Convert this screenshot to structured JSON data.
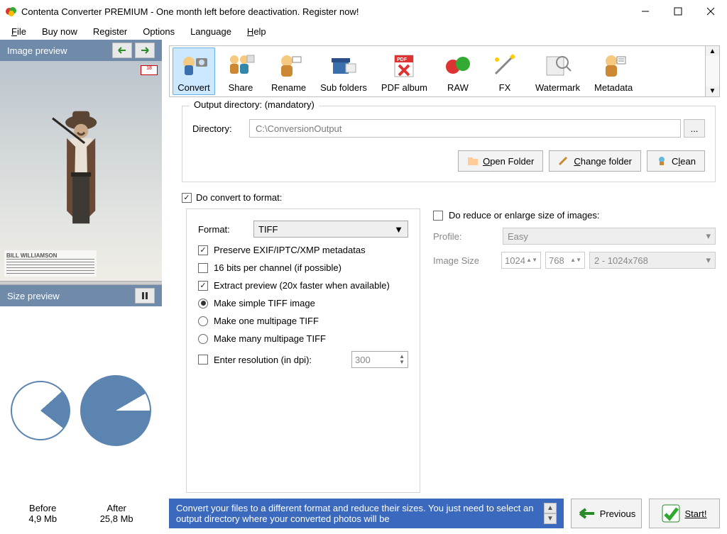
{
  "titlebar": {
    "text": "Contenta Converter PREMIUM  - One month left before deactivation. Register now!"
  },
  "menubar": {
    "file": "File",
    "file_u": "F",
    "buynow": "Buy now",
    "register": "Register",
    "options": "Options",
    "language": "Language",
    "help": "Help",
    "help_u": "H"
  },
  "sidebar": {
    "image_preview": "Image preview",
    "size_preview": "Size preview",
    "before_label": "Before",
    "before_value": "4,9 Mb",
    "after_label": "After",
    "after_value": "25,8 Mb",
    "caption_text": "BILL WILLIAMSON"
  },
  "toolbar": {
    "convert": "Convert",
    "share": "Share",
    "rename": "Rename",
    "subfolders": "Sub folders",
    "pdf": "PDF album",
    "raw": "RAW",
    "fx": "FX",
    "watermark": "Watermark",
    "metadata": "Metadata"
  },
  "output": {
    "group_title": "Output directory: (mandatory)",
    "dir_label": "Directory:",
    "dir_value": "C:\\ConversionOutput",
    "browse": "...",
    "open_folder": "Open Folder",
    "change_folder": "Change folder",
    "clean": "Clean"
  },
  "convert": {
    "do_convert": "Do convert to format:",
    "format_label": "Format:",
    "format_value": "TIFF",
    "preserve": "Preserve EXIF/IPTC/XMP metadatas",
    "bits16": "16 bits per channel (if possible)",
    "extract": "Extract preview (20x faster when available)",
    "radio_simple": "Make simple TIFF image",
    "radio_one": "Make one multipage TIFF",
    "radio_many": "Make many multipage TIFF",
    "enter_res": "Enter resolution (in dpi):",
    "res_value": "300"
  },
  "resize": {
    "do_reduce": "Do reduce or enlarge size of images:",
    "profile_label": "Profile:",
    "profile_value": "Easy",
    "imgsize_label": "Image Size",
    "width": "1024",
    "height": "768",
    "preset": "2 - 1024x768"
  },
  "footer": {
    "info": "Convert your files to a different format and reduce their sizes. You just need to select an output directory where your converted photos will be",
    "previous": "Previous",
    "start": "Start!"
  },
  "chart_data": {
    "type": "pie",
    "series": [
      {
        "name": "Before",
        "total_mb": 4.9,
        "slices": [
          {
            "label": "filled",
            "value": 22
          },
          {
            "label": "empty",
            "value": 78
          }
        ]
      },
      {
        "name": "After",
        "total_mb": 25.8,
        "slices": [
          {
            "label": "filled",
            "value": 92
          },
          {
            "label": "empty",
            "value": 8
          }
        ]
      }
    ]
  }
}
